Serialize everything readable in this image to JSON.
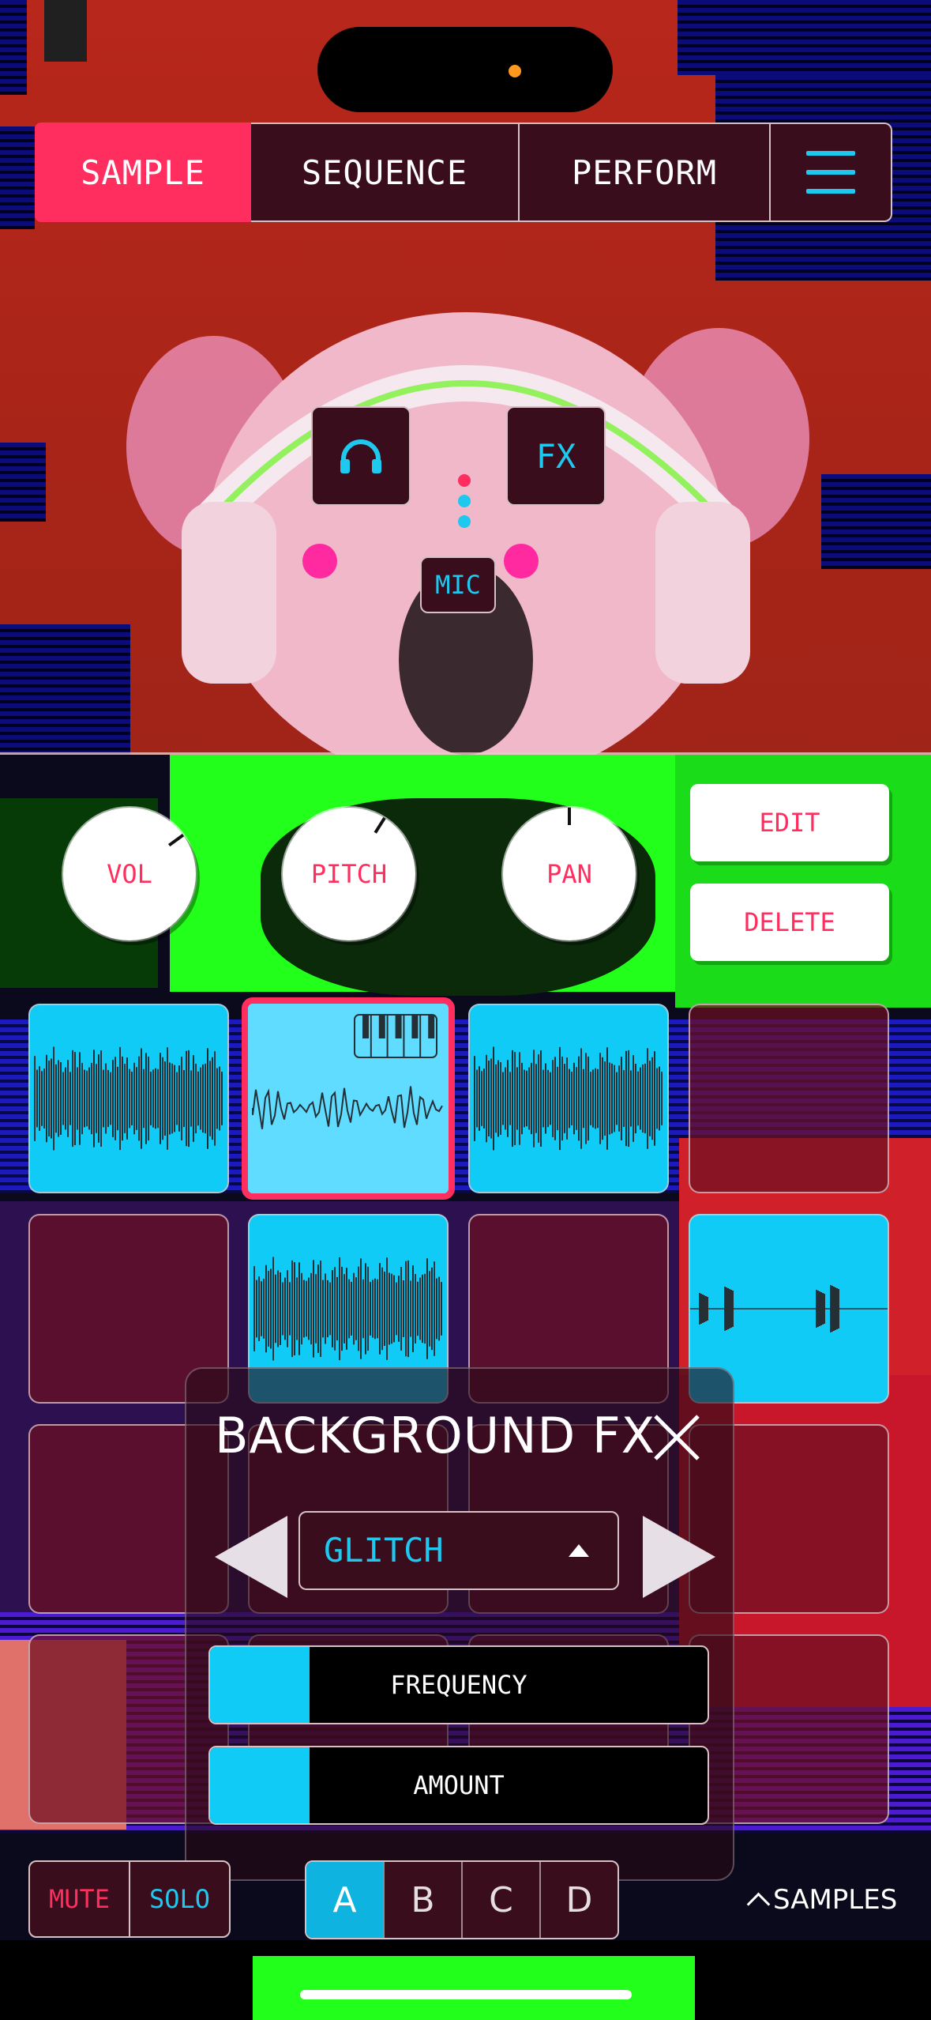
{
  "nav": {
    "tabs": [
      {
        "label": "SAMPLE",
        "active": true
      },
      {
        "label": "SEQUENCE",
        "active": false
      },
      {
        "label": "PERFORM",
        "active": false
      }
    ],
    "menu_icon": "hamburger-menu-icon"
  },
  "preview": {
    "monitor_icon": "headphones-icon",
    "fx_label": "FX",
    "mic_label": "MIC"
  },
  "knobs": [
    {
      "label": "VOL",
      "value": 0.7
    },
    {
      "label": "PITCH",
      "value": 0.62
    },
    {
      "label": "PAN",
      "value": 0.5
    }
  ],
  "actions": {
    "edit_label": "EDIT",
    "delete_label": "DELETE"
  },
  "pads": {
    "rows": [
      [
        "dense",
        "keys",
        "dense",
        "empty"
      ],
      [
        "empty",
        "dense",
        "empty",
        "sparse"
      ],
      [
        "empty",
        "empty",
        "empty",
        "empty"
      ],
      [
        "empty",
        "empty",
        "empty",
        "empty"
      ]
    ],
    "selected": [
      0,
      1
    ]
  },
  "bg_fx": {
    "title": "BACKGROUND FX",
    "close_icon": "close-icon",
    "effect": "GLITCH",
    "sliders": [
      {
        "label": "FREQUENCY",
        "value": 0.2
      },
      {
        "label": "AMOUNT",
        "value": 0.2
      }
    ]
  },
  "bottom": {
    "mute_label": "MUTE",
    "solo_label": "SOLO",
    "banks": [
      "A",
      "B",
      "C",
      "D"
    ],
    "active_bank": "A",
    "samples_label": "SAMPLES"
  },
  "colors": {
    "accent_pink": "#ff2e5f",
    "accent_cyan": "#1ec8ef",
    "pad_cyan": "#0fcbf6"
  }
}
